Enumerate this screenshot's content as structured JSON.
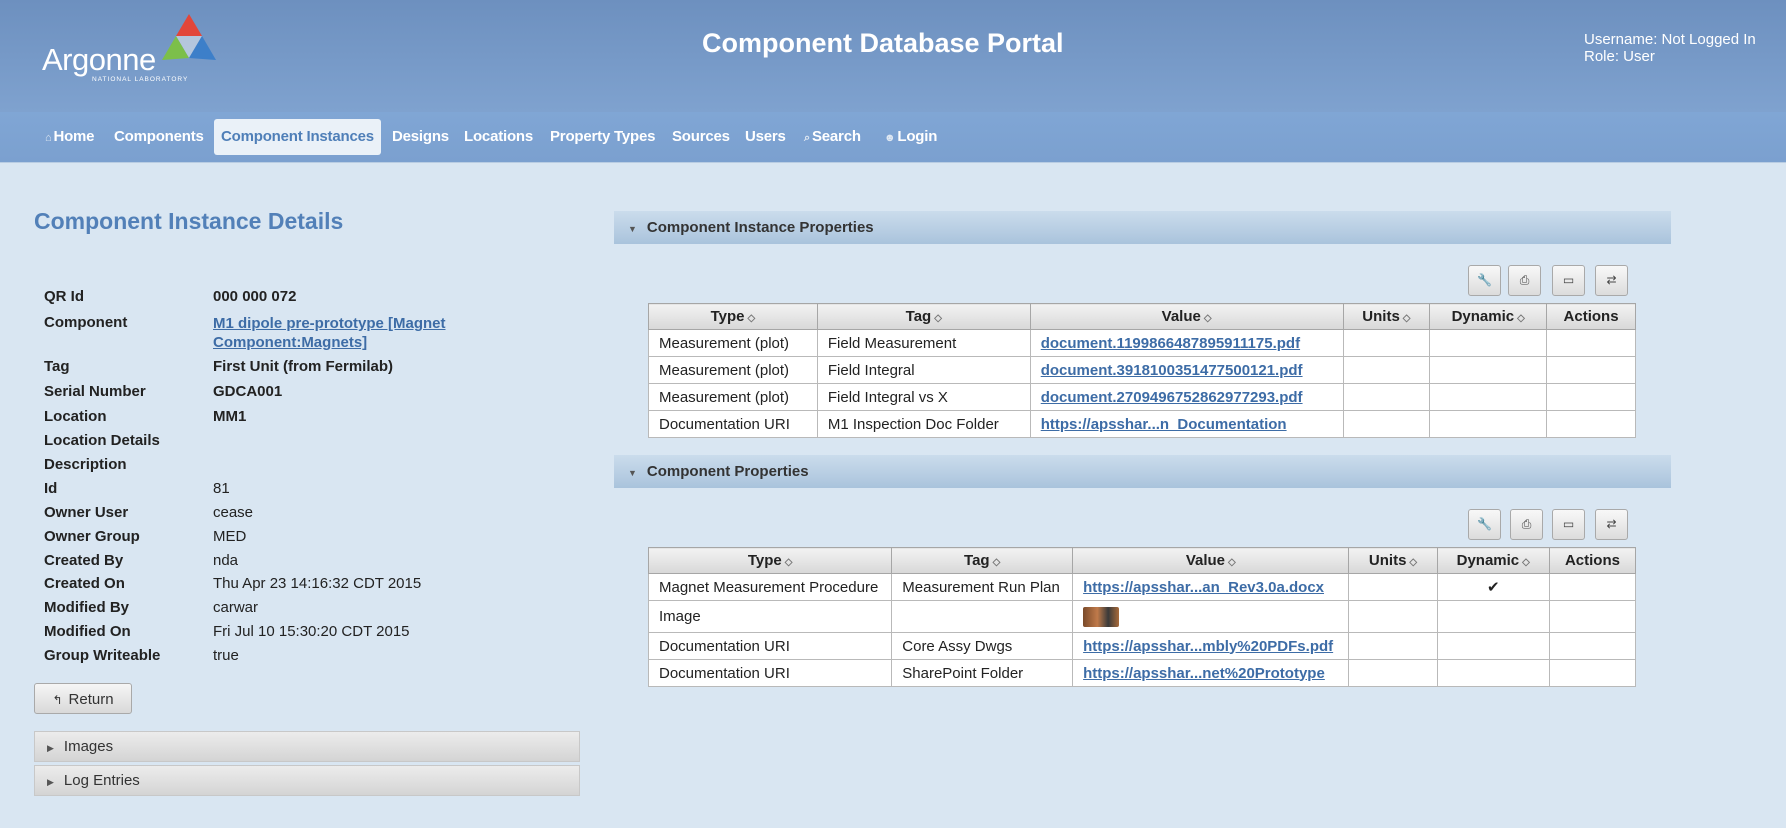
{
  "header": {
    "logo_text": "Argonne",
    "logo_sub": "NATIONAL LABORATORY",
    "title": "Component Database Portal",
    "username": "Username: Not Logged In",
    "role": "Role: User"
  },
  "nav": {
    "items": [
      {
        "label": "Home",
        "icon": "home-icon"
      },
      {
        "label": "Components"
      },
      {
        "label": "Component Instances",
        "active": true
      },
      {
        "label": "Designs"
      },
      {
        "label": "Locations"
      },
      {
        "label": "Property Types"
      },
      {
        "label": "Sources"
      },
      {
        "label": "Users"
      },
      {
        "label": "Search",
        "icon": "search-icon"
      },
      {
        "label": "Login",
        "icon": "user-icon"
      }
    ]
  },
  "details": {
    "title": "Component Instance Details",
    "rows": [
      {
        "label": "QR Id",
        "value": "000 000 072"
      },
      {
        "label": "Component",
        "value": "M1 dipole pre-prototype [Magnet",
        "value2": "Component:Magnets]"
      },
      {
        "label": "Tag",
        "value": "First Unit (from Fermilab)"
      },
      {
        "label": "Serial Number",
        "value": "GDCA001"
      },
      {
        "label": "Location",
        "value": "MM1"
      },
      {
        "label": "Location Details",
        "value": ""
      },
      {
        "label": "Description",
        "value": ""
      },
      {
        "label": "Id",
        "value": "81"
      },
      {
        "label": "Owner User",
        "value": "cease"
      },
      {
        "label": "Owner Group",
        "value": "MED"
      },
      {
        "label": "Created By",
        "value": "nda"
      },
      {
        "label": "Created On",
        "value": "Thu Apr 23 14:16:32 CDT 2015"
      },
      {
        "label": "Modified By",
        "value": "carwar"
      },
      {
        "label": "Modified On",
        "value": "Fri Jul 10 15:30:20 CDT 2015"
      },
      {
        "label": "Group Writeable",
        "value": "true"
      }
    ],
    "return_label": "Return",
    "accordions": [
      "Images",
      "Log Entries"
    ]
  },
  "instance_props": {
    "title": "Component Instance Properties",
    "headers": [
      "Type",
      "Tag",
      "Value",
      "Units",
      "Dynamic",
      "Actions"
    ],
    "rows": [
      {
        "type": "Measurement (plot)",
        "tag": "Field Measurement",
        "value": "document.1199866487895911175.pdf"
      },
      {
        "type": "Measurement (plot)",
        "tag": "Field Integral",
        "value": "document.3918100351477500121.pdf"
      },
      {
        "type": "Measurement (plot)",
        "tag": "Field Integral vs X",
        "value": "document.2709496752862977293.pdf"
      },
      {
        "type": "Documentation URI",
        "tag": "M1 Inspection Doc Folder",
        "value": "https://apsshar...n_Documentation"
      }
    ]
  },
  "component_props": {
    "title": "Component Properties",
    "headers": [
      "Type",
      "Tag",
      "Value",
      "Units",
      "Dynamic",
      "Actions"
    ],
    "rows": [
      {
        "type": "Magnet Measurement Procedure",
        "tag": "Measurement Run Plan",
        "value": "https://apsshar...an_Rev3.0a.docx",
        "dynamic": "✔"
      },
      {
        "type": "Image",
        "tag": "",
        "value": "",
        "image": true
      },
      {
        "type": "Documentation URI",
        "tag": "Core Assy Dwgs",
        "value": "https://apsshar...mbly%20PDFs.pdf"
      },
      {
        "type": "Documentation URI",
        "tag": "SharePoint Folder",
        "value": "https://apsshar...net%20Prototype"
      }
    ]
  },
  "toolbar_icons": [
    "wrench-icon",
    "print-icon",
    "columns-icon",
    "export-icon"
  ]
}
